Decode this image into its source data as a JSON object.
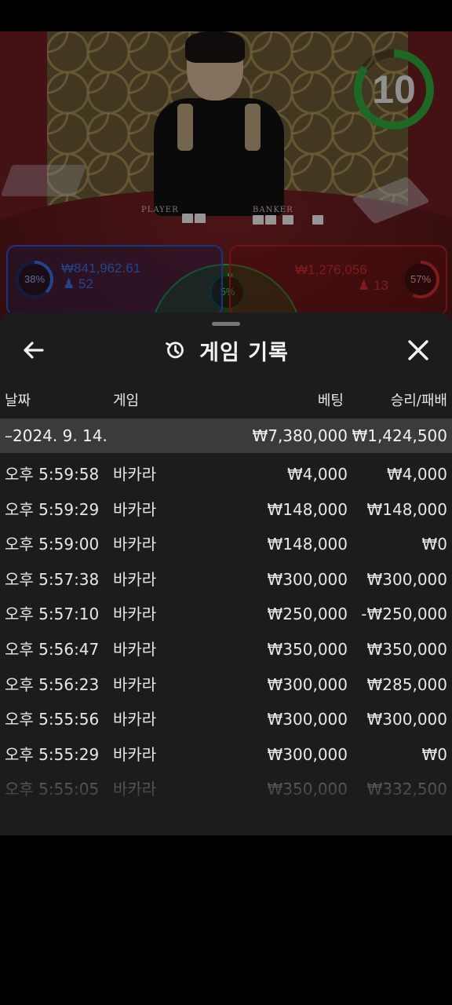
{
  "timer": {
    "value": "10",
    "progress": 0.85,
    "color": "#2fa83a"
  },
  "table_labels": {
    "player": "PLAYER",
    "banker": "BANKER"
  },
  "player": {
    "percent": "38%",
    "amount": "₩841,962.61",
    "count": "52",
    "color": "#3a6fe0"
  },
  "banker": {
    "percent": "57%",
    "amount": "₩1,276,056",
    "count": "13",
    "color": "#d02a2a"
  },
  "tie": {
    "percent": "5%",
    "color": "#35b545"
  },
  "sheet": {
    "title": "게임 기록",
    "title_icon": "history-icon",
    "back_icon": "back-arrow-icon",
    "close_icon": "close-icon"
  },
  "columns": {
    "date": "날짜",
    "game": "게임",
    "bet": "베팅",
    "result": "승리/패배"
  },
  "date_group": {
    "date": "–2024. 9. 14.",
    "bet_total": "₩7,380,000",
    "result_total": "₩1,424,500"
  },
  "rows": [
    {
      "time": "오후 5:59:58",
      "game": "바카라",
      "bet": "₩4,000",
      "result": "₩4,000"
    },
    {
      "time": "오후 5:59:29",
      "game": "바카라",
      "bet": "₩148,000",
      "result": "₩148,000"
    },
    {
      "time": "오후 5:59:00",
      "game": "바카라",
      "bet": "₩148,000",
      "result": "₩0"
    },
    {
      "time": "오후 5:57:38",
      "game": "바카라",
      "bet": "₩300,000",
      "result": "₩300,000"
    },
    {
      "time": "오후 5:57:10",
      "game": "바카라",
      "bet": "₩250,000",
      "result": "-₩250,000"
    },
    {
      "time": "오후 5:56:47",
      "game": "바카라",
      "bet": "₩350,000",
      "result": "₩350,000"
    },
    {
      "time": "오후 5:56:23",
      "game": "바카라",
      "bet": "₩300,000",
      "result": "₩285,000"
    },
    {
      "time": "오후 5:55:56",
      "game": "바카라",
      "bet": "₩300,000",
      "result": "₩300,000"
    },
    {
      "time": "오후 5:55:29",
      "game": "바카라",
      "bet": "₩300,000",
      "result": "₩0"
    },
    {
      "time": "오후 5:55:05",
      "game": "바카라",
      "bet": "₩350,000",
      "result": "₩332,500"
    }
  ]
}
